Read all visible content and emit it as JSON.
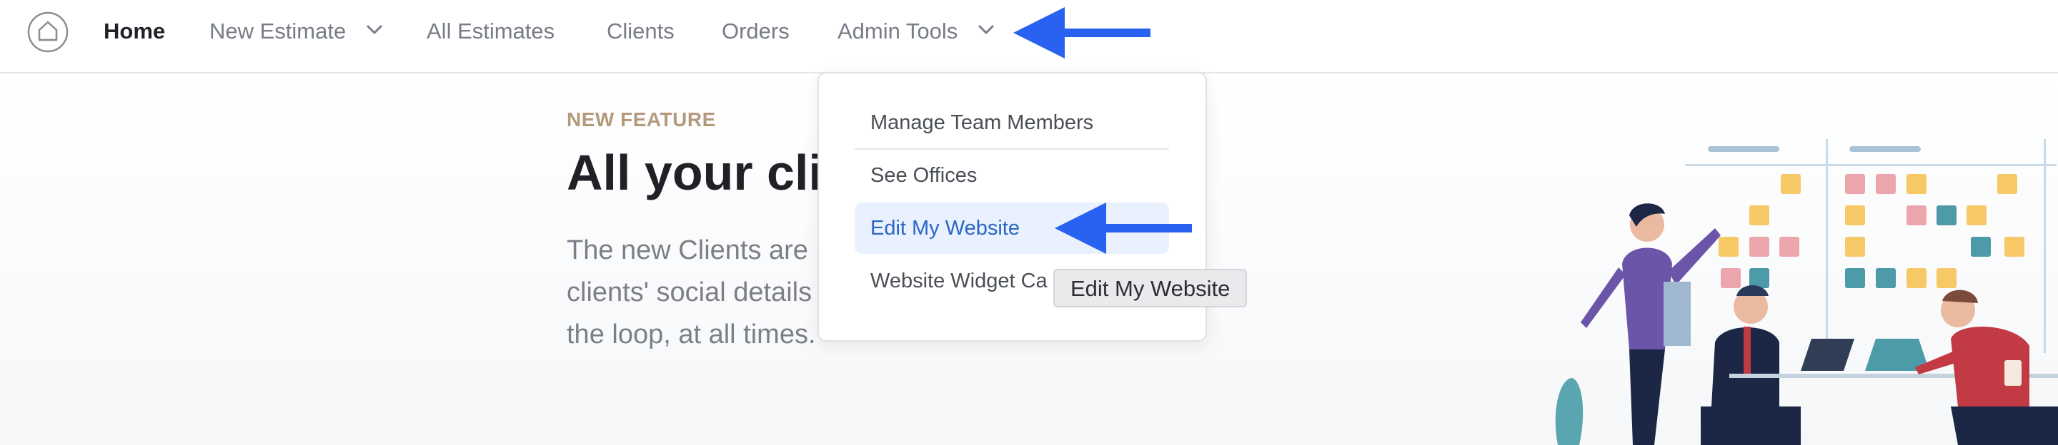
{
  "nav": {
    "items": [
      {
        "label": "Home",
        "active": true
      },
      {
        "label": "New Estimate",
        "has_dropdown": true
      },
      {
        "label": "All Estimates"
      },
      {
        "label": "Clients"
      },
      {
        "label": "Orders"
      },
      {
        "label": "Admin Tools",
        "has_dropdown": true,
        "open": true
      }
    ],
    "logo_icon": "home-logo-icon"
  },
  "hero": {
    "eyebrow": "NEW FEATURE",
    "headline": "All your cli",
    "paragraph_line1": "The new Clients are",
    "paragraph_line2": "clients' social details and estimates activity. Stay in",
    "paragraph_line3": "the loop, at all times."
  },
  "admin_menu": {
    "items": [
      {
        "label": "Manage Team Members"
      },
      {
        "label": "See Offices"
      },
      {
        "label": "Edit My Website",
        "highlighted": true
      },
      {
        "label": "Website Widget Ca"
      }
    ]
  },
  "tooltip": "Edit My Website",
  "colors": {
    "accent_blue": "#2962f0",
    "highlight_bg": "#e8f1fd",
    "eyebrow": "#b39a7c"
  }
}
